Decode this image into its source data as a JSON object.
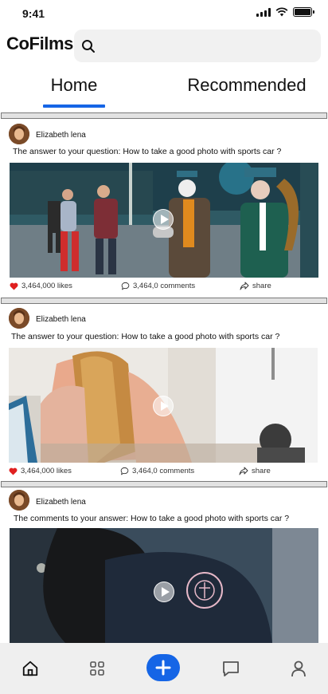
{
  "status": {
    "time": "9:41"
  },
  "app": {
    "name": "CoFilms",
    "search": {
      "value": "",
      "placeholder": ""
    }
  },
  "tabs": [
    {
      "label": "Home",
      "active": true
    },
    {
      "label": "Recommended",
      "active": false
    }
  ],
  "colors": {
    "accent": "#1565e6",
    "like": "#e02020",
    "nav_bg": "#efefef"
  },
  "posts": [
    {
      "author": "Elizabeth lena",
      "caption": "The answer to your question: How to take a good photo with sports car ?",
      "likes": "3,464,000 likes",
      "comments": "3,464,0 comments",
      "share": "share"
    },
    {
      "author": "Elizabeth lena",
      "caption": "The answer to your question: How to take a good photo with sports car ?",
      "likes": "3,464,000 likes",
      "comments": "3,464,0 comments",
      "share": "share"
    },
    {
      "author": "Elizabeth lena",
      "caption": "The comments to your answer: How to take a good photo with sports car ?"
    }
  ],
  "nav": {
    "items": [
      "home-icon",
      "grid-icon",
      "add-icon",
      "chat-icon",
      "profile-icon"
    ]
  }
}
